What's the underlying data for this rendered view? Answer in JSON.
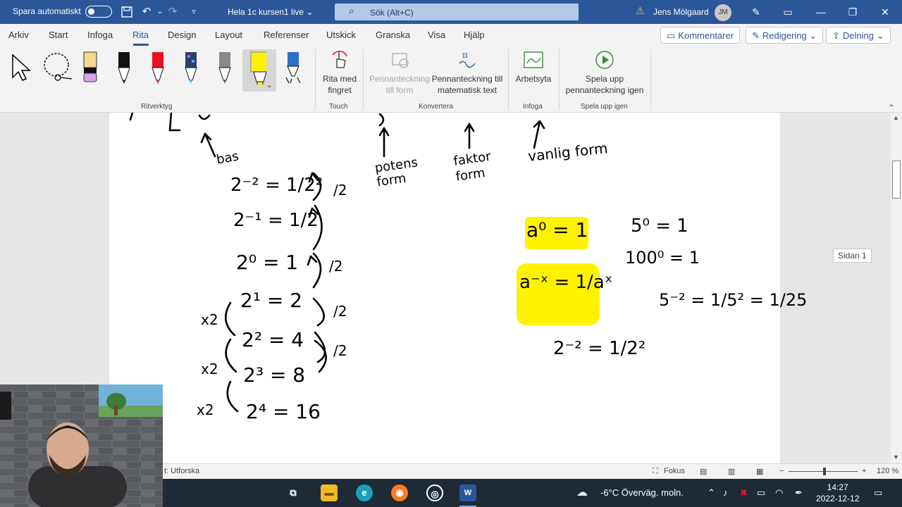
{
  "titlebar": {
    "autosave_label": "Spara automatiskt",
    "doc_title": "Hela 1c kursen1 live ⌄",
    "search_placeholder": "Sök (Alt+C)",
    "user_name": "Jens Mölgaard",
    "user_initials": "JM"
  },
  "tabs": [
    "Arkiv",
    "Start",
    "Infoga",
    "Rita",
    "Design",
    "Layout",
    "Referenser",
    "Utskick",
    "Granska",
    "Visa",
    "Hjälp"
  ],
  "ribbon_actions": {
    "comments": "Kommentarer",
    "editing": "Redigering ⌄",
    "sharing": "Delning ⌄"
  },
  "ribbon": {
    "touch_button": "Rita med fingret",
    "ink_to_shape": "Pennanteckning till form",
    "ink_to_math": "Pennanteckning till matematisk text",
    "canvas": "Arbetsyta",
    "replay": "Spela upp pennanteckning igen",
    "groups": {
      "tools": "Ritverktyg",
      "touch": "Touch",
      "convert": "Konvertera",
      "insert": "Infoga",
      "replay": "Spela upp igen"
    },
    "pen_colors": [
      "#000000",
      "#000000",
      "#e81123",
      "#3a6ea5",
      "#9c9c9c",
      "#fff200",
      "#2b70c9"
    ]
  },
  "page_tag": "Sidan 1",
  "handwriting": {
    "top_labels": [
      "bas",
      "potens form",
      "faktor form",
      "vanlig form"
    ],
    "left_column": [
      "2⁻² = 1/2²",
      "2⁻¹ = 1/2",
      "2⁰ = 1",
      "2¹ = 2",
      "2² = 4",
      "2³ = 8",
      "2⁴ = 16"
    ],
    "left_arrows": [
      "/2",
      "/2",
      "/2",
      "/2",
      "x2",
      "x2",
      "x2"
    ],
    "highlighted": [
      "a⁰ = 1",
      "a⁻ˣ = 1/aˣ"
    ],
    "right_examples": [
      "5⁰ = 1",
      "100⁰ = 1",
      "5⁻² = 1/5² = 1/25",
      "2⁻² = 1/2²"
    ]
  },
  "status": {
    "explore": "t: Utforska",
    "focus": "Fokus",
    "zoom": "120 %"
  },
  "taskbar": {
    "weather": "-6°C  Överväg. moln.",
    "time": "14:27",
    "date": "2022-12-12"
  }
}
